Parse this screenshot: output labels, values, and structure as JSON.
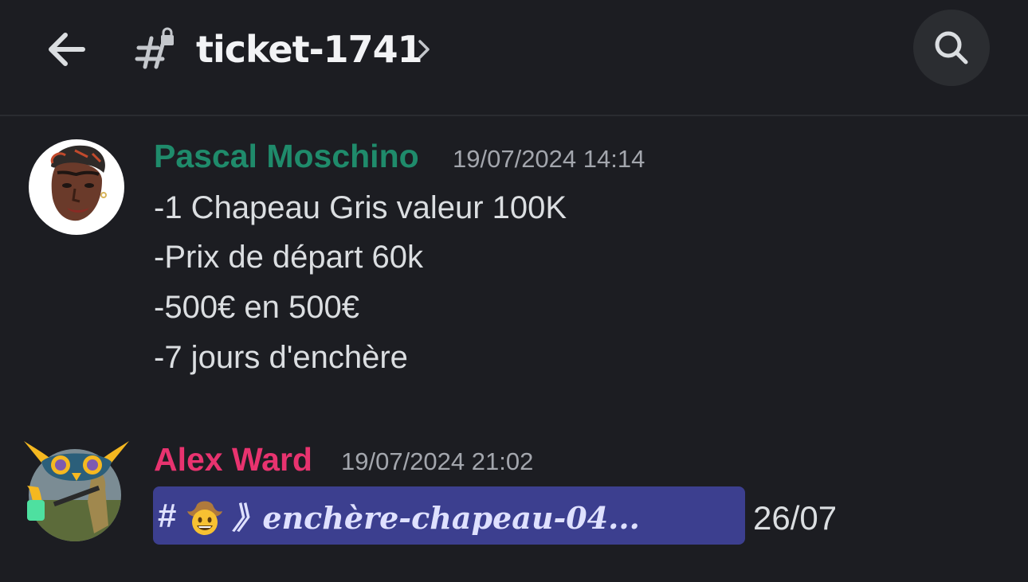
{
  "header": {
    "channel_name": "ticket-1741",
    "back_icon": "arrow-left-icon",
    "channel_icon": "locked-hash-icon",
    "chevron_icon": "chevron-right-icon",
    "search_icon": "search-icon"
  },
  "messages": [
    {
      "author": "Pascal Moschino",
      "author_color": "#1f8b6b",
      "timestamp": "19/07/2024 14:14",
      "lines": [
        "-1 Chapeau Gris valeur 100K",
        "-Prix de départ 60k",
        "-500€ en 500€",
        "-7 jours d'enchère"
      ]
    },
    {
      "author": "Alex Ward",
      "author_color": "#e8336f",
      "timestamp": "19/07/2024 21:02",
      "channel_mention": {
        "hash": "#",
        "emoji": "cowboy-face-icon",
        "text": "》𝒆𝒏𝒄𝒉è𝒓𝒆-𝒄𝒉𝒂𝒑𝒆𝒂𝒖-04..."
      },
      "suffix_text": "26/07"
    }
  ],
  "colors": {
    "background": "#1c1d22",
    "mention_bg": "#3c3f8f",
    "timestamp": "#a3a6ad"
  }
}
